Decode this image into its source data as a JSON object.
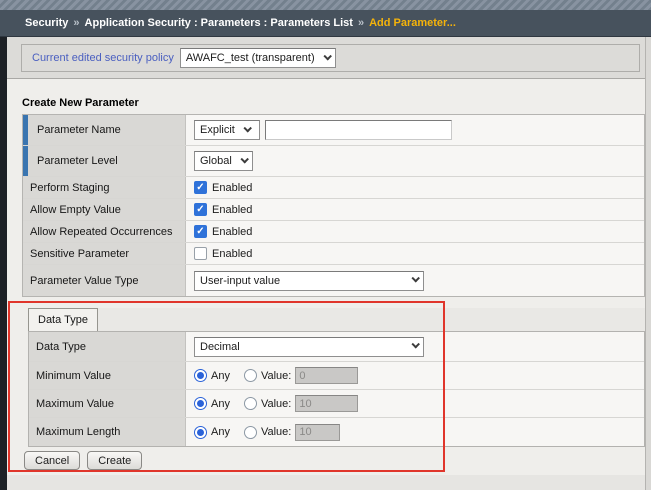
{
  "breadcrumb": {
    "root": "Security",
    "separator": "»",
    "path": "Application Security : Parameters : Parameters List",
    "current": "Add Parameter..."
  },
  "policy_bar": {
    "label": "Current edited security policy",
    "selected_policy": "AWAFC_test (transparent)"
  },
  "create_form": {
    "title": "Create New Parameter",
    "parameter_name": {
      "label": "Parameter Name",
      "kind_selected": "Explicit",
      "name_value": ""
    },
    "parameter_level": {
      "label": "Parameter Level",
      "selected": "Global"
    },
    "toggles": [
      {
        "label": "Perform Staging",
        "option": "Enabled",
        "checked": true
      },
      {
        "label": "Allow Empty Value",
        "option": "Enabled",
        "checked": true
      },
      {
        "label": "Allow Repeated Occurrences",
        "option": "Enabled",
        "checked": true
      },
      {
        "label": "Sensitive Parameter",
        "option": "Enabled",
        "checked": false
      }
    ],
    "parameter_value_type": {
      "label": "Parameter Value Type",
      "selected": "User-input value"
    }
  },
  "data_type_panel": {
    "tab_label": "Data Type",
    "data_type": {
      "label": "Data Type",
      "selected": "Decimal"
    },
    "constraints": [
      {
        "label": "Minimum Value",
        "any_label": "Any",
        "value_label": "Value:",
        "value": "0",
        "any_selected": true
      },
      {
        "label": "Maximum Value",
        "any_label": "Any",
        "value_label": "Value:",
        "value": "10",
        "any_selected": true
      },
      {
        "label": "Maximum Length",
        "any_label": "Any",
        "value_label": "Value:",
        "value": "10",
        "any_selected": true
      }
    ]
  },
  "actions": {
    "cancel": "Cancel",
    "create": "Create"
  },
  "colors": {
    "breadcrumb_bg": "#47525d",
    "breadcrumb_highlight": "#f5b30a",
    "row_accent_blue": "#3a75b0",
    "checkbox_blue": "#2f72d9",
    "link_blue": "#4a5fc0",
    "annotation_red": "#e0352b"
  }
}
